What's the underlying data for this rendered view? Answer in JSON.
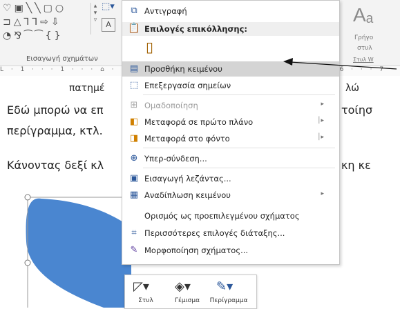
{
  "ribbon": {
    "shape_rows": [
      [
        "♡",
        "▣",
        "╲",
        "╲",
        "▢",
        "○",
        "▾"
      ],
      [
        "⊐",
        "△",
        "⅂",
        "⅂",
        "⇨",
        "⇩",
        "▾"
      ],
      [
        "◔",
        "⅋",
        "⁀",
        "⁀",
        "{",
        "}",
        "▿"
      ]
    ],
    "group_label": "Εισαγωγή σχημάτων",
    "styles_big": "Aₐ",
    "styles_sub1": "Γρήγο",
    "styles_sub2": "στυλ",
    "styles_sub3": "Στυλ W",
    "ruler_text": "L · 1 · · · 1 · · · ⌂ · · · 1 · · · 2 · · · 3 · · · 4 · · · 5 · · · 6 · · · 7"
  },
  "document": {
    "line_partial": "πατημέ",
    "line_partial_right": "λώ",
    "line1_left": "Εδώ μπορώ να επ",
    "line1_right": "τοίησ",
    "line2_left": "περίγραμμα, κτλ.",
    "line3_left": "Κάνοντας δεξί κλ",
    "line3_right": "κη κε"
  },
  "context_menu": {
    "copy": "Αντιγραφή",
    "paste_options": "Επιλογές επικόλλησης:",
    "items": [
      {
        "label": "Προσθήκη κειμένου",
        "icon": "textbox-icon",
        "glyph": "▤",
        "highlight": true,
        "disabled": false,
        "submenu": false
      },
      {
        "label": "Επεξεργασία σημείων",
        "icon": "edit-points-icon",
        "glyph": "⬚",
        "highlight": false,
        "disabled": false,
        "submenu": false
      },
      {
        "label": "Ομαδοποίηση",
        "icon": "group-icon",
        "glyph": "⊞",
        "highlight": false,
        "disabled": true,
        "submenu": true
      },
      {
        "label": "Μεταφορά σε πρώτο πλάνο",
        "icon": "bring-forward-icon",
        "glyph": "◧",
        "highlight": false,
        "disabled": false,
        "submenu": true
      },
      {
        "label": "Μεταφορά στο φόντο",
        "icon": "send-backward-icon",
        "glyph": "◨",
        "highlight": false,
        "disabled": false,
        "submenu": true
      },
      {
        "label": "Υπερ-σύνδεση...",
        "icon": "hyperlink-icon",
        "glyph": "⊕",
        "highlight": false,
        "disabled": false,
        "submenu": false
      },
      {
        "label": "Εισαγωγή λεζάντας...",
        "icon": "caption-icon",
        "glyph": "▣",
        "highlight": false,
        "disabled": false,
        "submenu": false
      },
      {
        "label": "Αναδίπλωση κειμένου",
        "icon": "wrap-text-icon",
        "glyph": "▦",
        "highlight": false,
        "disabled": false,
        "submenu": true
      },
      {
        "label": "Ορισμός ως προεπιλεγμένου σχήματος",
        "icon": "",
        "glyph": "",
        "highlight": false,
        "disabled": false,
        "submenu": false
      },
      {
        "label": "Περισσότερες επιλογές διάταξης...",
        "icon": "layout-options-icon",
        "glyph": "⌗",
        "highlight": false,
        "disabled": false,
        "submenu": false
      },
      {
        "label": "Μορφοποίηση σχήματος...",
        "icon": "format-shape-icon",
        "glyph": "✎",
        "highlight": false,
        "disabled": false,
        "submenu": false
      }
    ]
  },
  "float_toolbar": {
    "style_label": "Στυλ",
    "fill_label": "Γέμισμα",
    "outline_label": "Περίγραμμα"
  },
  "colors": {
    "shape_fill": "#4a86d0",
    "accent": "#2b579a"
  }
}
